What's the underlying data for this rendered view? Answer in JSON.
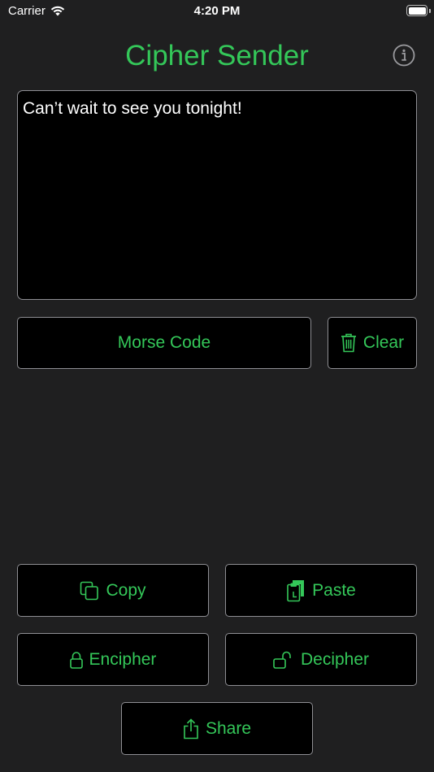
{
  "status_bar": {
    "carrier": "Carrier",
    "time": "4:20 PM"
  },
  "header": {
    "title": "Cipher Sender"
  },
  "message": {
    "text": "Can’t wait to see you tonight!"
  },
  "buttons": {
    "morse": "Morse Code",
    "clear": "Clear",
    "copy": "Copy",
    "paste": "Paste",
    "encipher": "Encipher",
    "decipher": "Decipher",
    "share": "Share"
  },
  "icons": {
    "info": "info-circle-icon",
    "clear": "trash-icon",
    "copy": "copy-icon",
    "paste": "paste-icon",
    "encipher": "lock-icon",
    "decipher": "unlock-icon",
    "share": "share-icon"
  },
  "colors": {
    "accent": "#34c759",
    "background": "#1f1f20",
    "panel": "#000000",
    "border": "#8e8e93",
    "text": "#ffffff"
  }
}
